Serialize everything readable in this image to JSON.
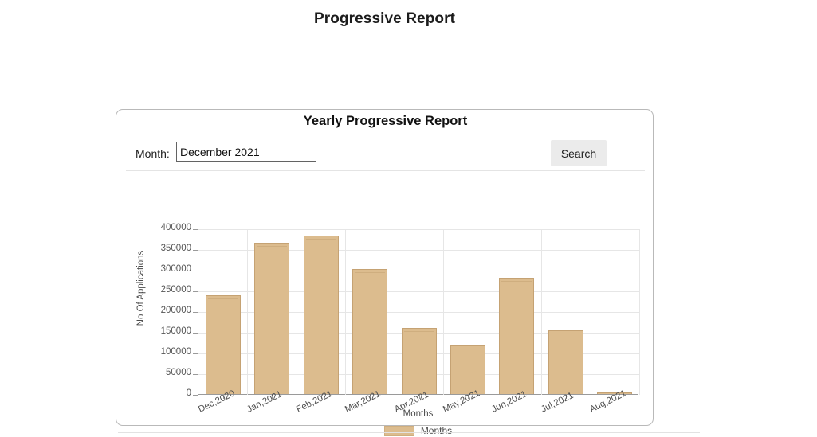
{
  "page": {
    "title": "Progressive Report"
  },
  "card": {
    "header": "Yearly Progressive Report",
    "search": {
      "month_label": "Month:",
      "month_value": "December 2021",
      "month_placeholder": "December 2021",
      "search_button": "Search"
    }
  },
  "colors": {
    "bar_fill": "#dcbc8e",
    "bar_stroke": "#c5a273",
    "button_bg": "#ebebeb",
    "grid": "#e6e6e6",
    "axis": "#9a9a9a"
  },
  "chart_data": {
    "type": "bar",
    "title": "",
    "xlabel": "Months",
    "ylabel": "No Of Applications",
    "ylim": [
      0,
      400000
    ],
    "ytick_step": 50000,
    "yticks": [
      "0",
      "50000",
      "100000",
      "150000",
      "200000",
      "250000",
      "300000",
      "350000",
      "400000"
    ],
    "grid": true,
    "legend_position": "bottom",
    "categories": [
      "Dec,2020",
      "Jan,2021",
      "Feb,2021",
      "Mar,2021",
      "Apr,2021",
      "May,2021",
      "Jun,2021",
      "Jul,2021",
      "Aug,2021"
    ],
    "series": [
      {
        "name": "Months",
        "values": [
          238000,
          365000,
          383000,
          301000,
          160000,
          117000,
          280000,
          153000,
          1500
        ]
      }
    ]
  }
}
